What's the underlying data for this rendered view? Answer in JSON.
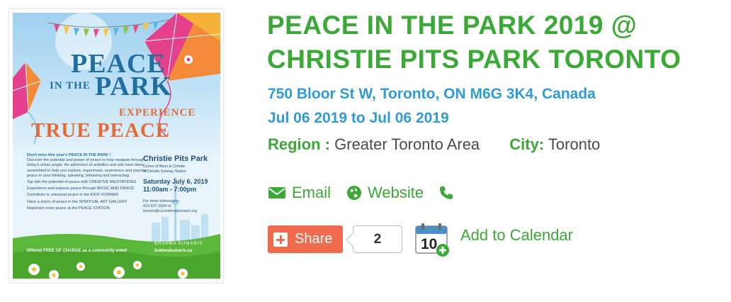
{
  "poster": {
    "title_line1": "PEACE",
    "title_line2": "IN THE",
    "title_line3": "PARK",
    "experience": "EXPERIENCE",
    "true_peace": "TRUE PEACE",
    "intro_bold": "Don't miss this year's PEACE IN THE PARK !",
    "intro": "Discover the potential and power of peace to help navigate through today's urban jungle. An adventure of activities and arts have been assembled to help you explore, experiment, experience and express peace in your thinking, speaking, behaving and interacting.",
    "bullets": [
      "Tap into the potential of peace with CREATIVE MEDITATIONS",
      "Experience and express peace through MUSIC AND DANCE",
      "Contribute to universal peace in the KIDS' KORNER",
      "Have a vision of peace in the SPIRITUAL ART GALLERY",
      "Replenish inner peace at the PEACE STATION"
    ],
    "location": "Christie Pits Park",
    "location_detail1": "Corner of Bloor & Christie",
    "location_detail2": "at Christie Subway Station",
    "date": "Saturday July 6, 2019",
    "time": "11:00am - 7:00pm",
    "info_label": "For more information:",
    "phone": "416-537-3034 or",
    "email": "toronto@ca.brahmakumaris.org",
    "org": "BRAHMA KUMARIS",
    "org_url": "brahmakumaris.ca",
    "free": "Offered FREE OF CHARGE as a community event"
  },
  "event": {
    "title": "PEACE IN THE PARK 2019 @ CHRISTIE PITS PARK TORONTO",
    "address": "750 Bloor St W, Toronto, ON M6G 3K4, Canada",
    "dates": "Jul 06 2019 to Jul 06 2019",
    "region_label": "Region :",
    "region_value": "Greater Toronto Area",
    "city_label": "City:",
    "city_value": "Toronto"
  },
  "contact": {
    "email_label": "Email",
    "website_label": "Website",
    "icons": [
      "envelope-icon",
      "globe-icon",
      "phone-icon"
    ]
  },
  "share": {
    "label": "Share",
    "count": "2"
  },
  "calendar": {
    "label": "Add to Calendar",
    "icon_day": "10"
  },
  "colors": {
    "green": "#3aa935",
    "blue": "#2f9bd6",
    "share": "#f06a4e",
    "text": "#4a4a4a"
  }
}
